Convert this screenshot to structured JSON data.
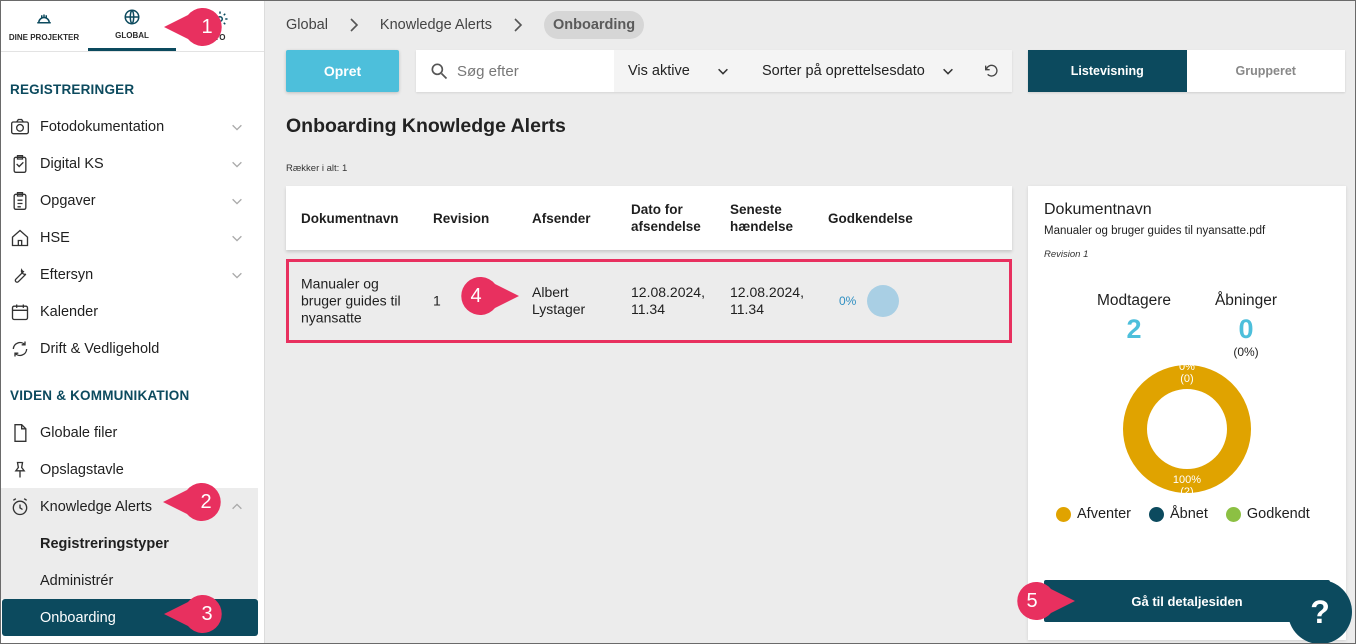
{
  "topnav": {
    "tabs": [
      {
        "label": "DINE PROJEKTER",
        "icon": "helmet-icon"
      },
      {
        "label": "GLOBAL",
        "icon": "globe-icon"
      },
      {
        "label": "TO",
        "icon": "gear-icon"
      }
    ]
  },
  "sidebar": {
    "section1": "REGISTRERINGER",
    "section2": "VIDEN & KOMMUNIKATION",
    "items": [
      {
        "label": "Fotodokumentation",
        "icon": "camera-icon"
      },
      {
        "label": "Digital KS",
        "icon": "clipboard-check-icon"
      },
      {
        "label": "Opgaver",
        "icon": "clipboard-list-icon"
      },
      {
        "label": "HSE",
        "icon": "house-icon"
      },
      {
        "label": "Eftersyn",
        "icon": "wrench-icon"
      },
      {
        "label": "Kalender",
        "icon": "calendar-icon"
      },
      {
        "label": "Drift & Vedligehold",
        "icon": "refresh-icon"
      },
      {
        "label": "Globale filer",
        "icon": "file-icon"
      },
      {
        "label": "Opslagstavle",
        "icon": "pin-icon"
      },
      {
        "label": "Knowledge Alerts",
        "icon": "alarm-clock-icon"
      }
    ],
    "sub_items": [
      {
        "label": "Registreringstyper"
      },
      {
        "label": "Administrér"
      },
      {
        "label": "Onboarding"
      }
    ]
  },
  "breadcrumb": [
    "Global",
    "Knowledge Alerts",
    "Onboarding"
  ],
  "toolbar": {
    "create_label": "Opret",
    "search_placeholder": "Søg efter",
    "filter_label": "Vis aktive",
    "sort_label": "Sorter på oprettelsesdato",
    "view_list": "Listevisning",
    "view_grouped": "Grupperet"
  },
  "page": {
    "title": "Onboarding Knowledge Alerts",
    "row_count": "Rækker i alt: 1"
  },
  "table": {
    "headers": [
      "Dokumentnavn",
      "Revision",
      "Afsender",
      "Dato for afsendelse",
      "Seneste hændelse",
      "Godkendelse"
    ],
    "rows": [
      {
        "name": "Manualer og bruger guides til nyansatte",
        "revision": "1",
        "sender": "Albert Lystager",
        "sent": "12.08.2024, 11.34",
        "latest": "12.08.2024, 11.34",
        "approval": "0%",
        "approval_fraction": 0
      }
    ]
  },
  "details": {
    "title": "Dokumentnavn",
    "file": "Manualer og bruger guides til nyansatte.pdf",
    "revision": "Revision 1",
    "recipients_label": "Modtagere",
    "recipients": "2",
    "opens_label": "Åbninger",
    "opens": "0",
    "opens_pct": "(0%)",
    "donut_top_pct": "0%",
    "donut_top_count": "(0)",
    "donut_bottom_pct": "100%",
    "donut_bottom_count": "(2)",
    "legend": [
      {
        "label": "Afventer",
        "color": "#e0a300"
      },
      {
        "label": "Åbnet",
        "color": "#0c4a5e"
      },
      {
        "label": "Godkendt",
        "color": "#8cc043"
      }
    ],
    "button_label": "Gå til detaljesiden"
  },
  "help_label": "?",
  "callouts": [
    "1",
    "2",
    "3",
    "4",
    "5"
  ],
  "colors": {
    "primary": "#0c4a5e",
    "accent": "#4dbfdb",
    "highlight": "#e8305f",
    "pending": "#e0a300"
  }
}
